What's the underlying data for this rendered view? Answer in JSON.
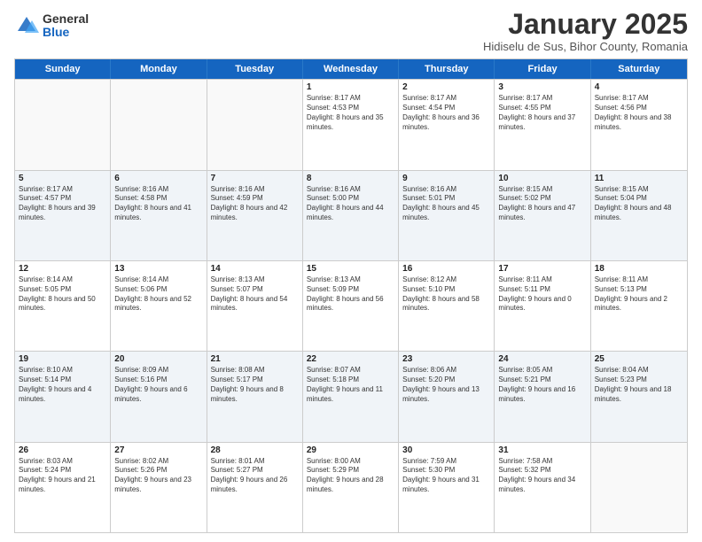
{
  "logo": {
    "general": "General",
    "blue": "Blue"
  },
  "title": "January 2025",
  "location": "Hidiselu de Sus, Bihor County, Romania",
  "weekdays": [
    "Sunday",
    "Monday",
    "Tuesday",
    "Wednesday",
    "Thursday",
    "Friday",
    "Saturday"
  ],
  "rows": [
    [
      {
        "day": "",
        "info": ""
      },
      {
        "day": "",
        "info": ""
      },
      {
        "day": "",
        "info": ""
      },
      {
        "day": "1",
        "info": "Sunrise: 8:17 AM\nSunset: 4:53 PM\nDaylight: 8 hours and 35 minutes."
      },
      {
        "day": "2",
        "info": "Sunrise: 8:17 AM\nSunset: 4:54 PM\nDaylight: 8 hours and 36 minutes."
      },
      {
        "day": "3",
        "info": "Sunrise: 8:17 AM\nSunset: 4:55 PM\nDaylight: 8 hours and 37 minutes."
      },
      {
        "day": "4",
        "info": "Sunrise: 8:17 AM\nSunset: 4:56 PM\nDaylight: 8 hours and 38 minutes."
      }
    ],
    [
      {
        "day": "5",
        "info": "Sunrise: 8:17 AM\nSunset: 4:57 PM\nDaylight: 8 hours and 39 minutes."
      },
      {
        "day": "6",
        "info": "Sunrise: 8:16 AM\nSunset: 4:58 PM\nDaylight: 8 hours and 41 minutes."
      },
      {
        "day": "7",
        "info": "Sunrise: 8:16 AM\nSunset: 4:59 PM\nDaylight: 8 hours and 42 minutes."
      },
      {
        "day": "8",
        "info": "Sunrise: 8:16 AM\nSunset: 5:00 PM\nDaylight: 8 hours and 44 minutes."
      },
      {
        "day": "9",
        "info": "Sunrise: 8:16 AM\nSunset: 5:01 PM\nDaylight: 8 hours and 45 minutes."
      },
      {
        "day": "10",
        "info": "Sunrise: 8:15 AM\nSunset: 5:02 PM\nDaylight: 8 hours and 47 minutes."
      },
      {
        "day": "11",
        "info": "Sunrise: 8:15 AM\nSunset: 5:04 PM\nDaylight: 8 hours and 48 minutes."
      }
    ],
    [
      {
        "day": "12",
        "info": "Sunrise: 8:14 AM\nSunset: 5:05 PM\nDaylight: 8 hours and 50 minutes."
      },
      {
        "day": "13",
        "info": "Sunrise: 8:14 AM\nSunset: 5:06 PM\nDaylight: 8 hours and 52 minutes."
      },
      {
        "day": "14",
        "info": "Sunrise: 8:13 AM\nSunset: 5:07 PM\nDaylight: 8 hours and 54 minutes."
      },
      {
        "day": "15",
        "info": "Sunrise: 8:13 AM\nSunset: 5:09 PM\nDaylight: 8 hours and 56 minutes."
      },
      {
        "day": "16",
        "info": "Sunrise: 8:12 AM\nSunset: 5:10 PM\nDaylight: 8 hours and 58 minutes."
      },
      {
        "day": "17",
        "info": "Sunrise: 8:11 AM\nSunset: 5:11 PM\nDaylight: 9 hours and 0 minutes."
      },
      {
        "day": "18",
        "info": "Sunrise: 8:11 AM\nSunset: 5:13 PM\nDaylight: 9 hours and 2 minutes."
      }
    ],
    [
      {
        "day": "19",
        "info": "Sunrise: 8:10 AM\nSunset: 5:14 PM\nDaylight: 9 hours and 4 minutes."
      },
      {
        "day": "20",
        "info": "Sunrise: 8:09 AM\nSunset: 5:16 PM\nDaylight: 9 hours and 6 minutes."
      },
      {
        "day": "21",
        "info": "Sunrise: 8:08 AM\nSunset: 5:17 PM\nDaylight: 9 hours and 8 minutes."
      },
      {
        "day": "22",
        "info": "Sunrise: 8:07 AM\nSunset: 5:18 PM\nDaylight: 9 hours and 11 minutes."
      },
      {
        "day": "23",
        "info": "Sunrise: 8:06 AM\nSunset: 5:20 PM\nDaylight: 9 hours and 13 minutes."
      },
      {
        "day": "24",
        "info": "Sunrise: 8:05 AM\nSunset: 5:21 PM\nDaylight: 9 hours and 16 minutes."
      },
      {
        "day": "25",
        "info": "Sunrise: 8:04 AM\nSunset: 5:23 PM\nDaylight: 9 hours and 18 minutes."
      }
    ],
    [
      {
        "day": "26",
        "info": "Sunrise: 8:03 AM\nSunset: 5:24 PM\nDaylight: 9 hours and 21 minutes."
      },
      {
        "day": "27",
        "info": "Sunrise: 8:02 AM\nSunset: 5:26 PM\nDaylight: 9 hours and 23 minutes."
      },
      {
        "day": "28",
        "info": "Sunrise: 8:01 AM\nSunset: 5:27 PM\nDaylight: 9 hours and 26 minutes."
      },
      {
        "day": "29",
        "info": "Sunrise: 8:00 AM\nSunset: 5:29 PM\nDaylight: 9 hours and 28 minutes."
      },
      {
        "day": "30",
        "info": "Sunrise: 7:59 AM\nSunset: 5:30 PM\nDaylight: 9 hours and 31 minutes."
      },
      {
        "day": "31",
        "info": "Sunrise: 7:58 AM\nSunset: 5:32 PM\nDaylight: 9 hours and 34 minutes."
      },
      {
        "day": "",
        "info": ""
      }
    ]
  ]
}
